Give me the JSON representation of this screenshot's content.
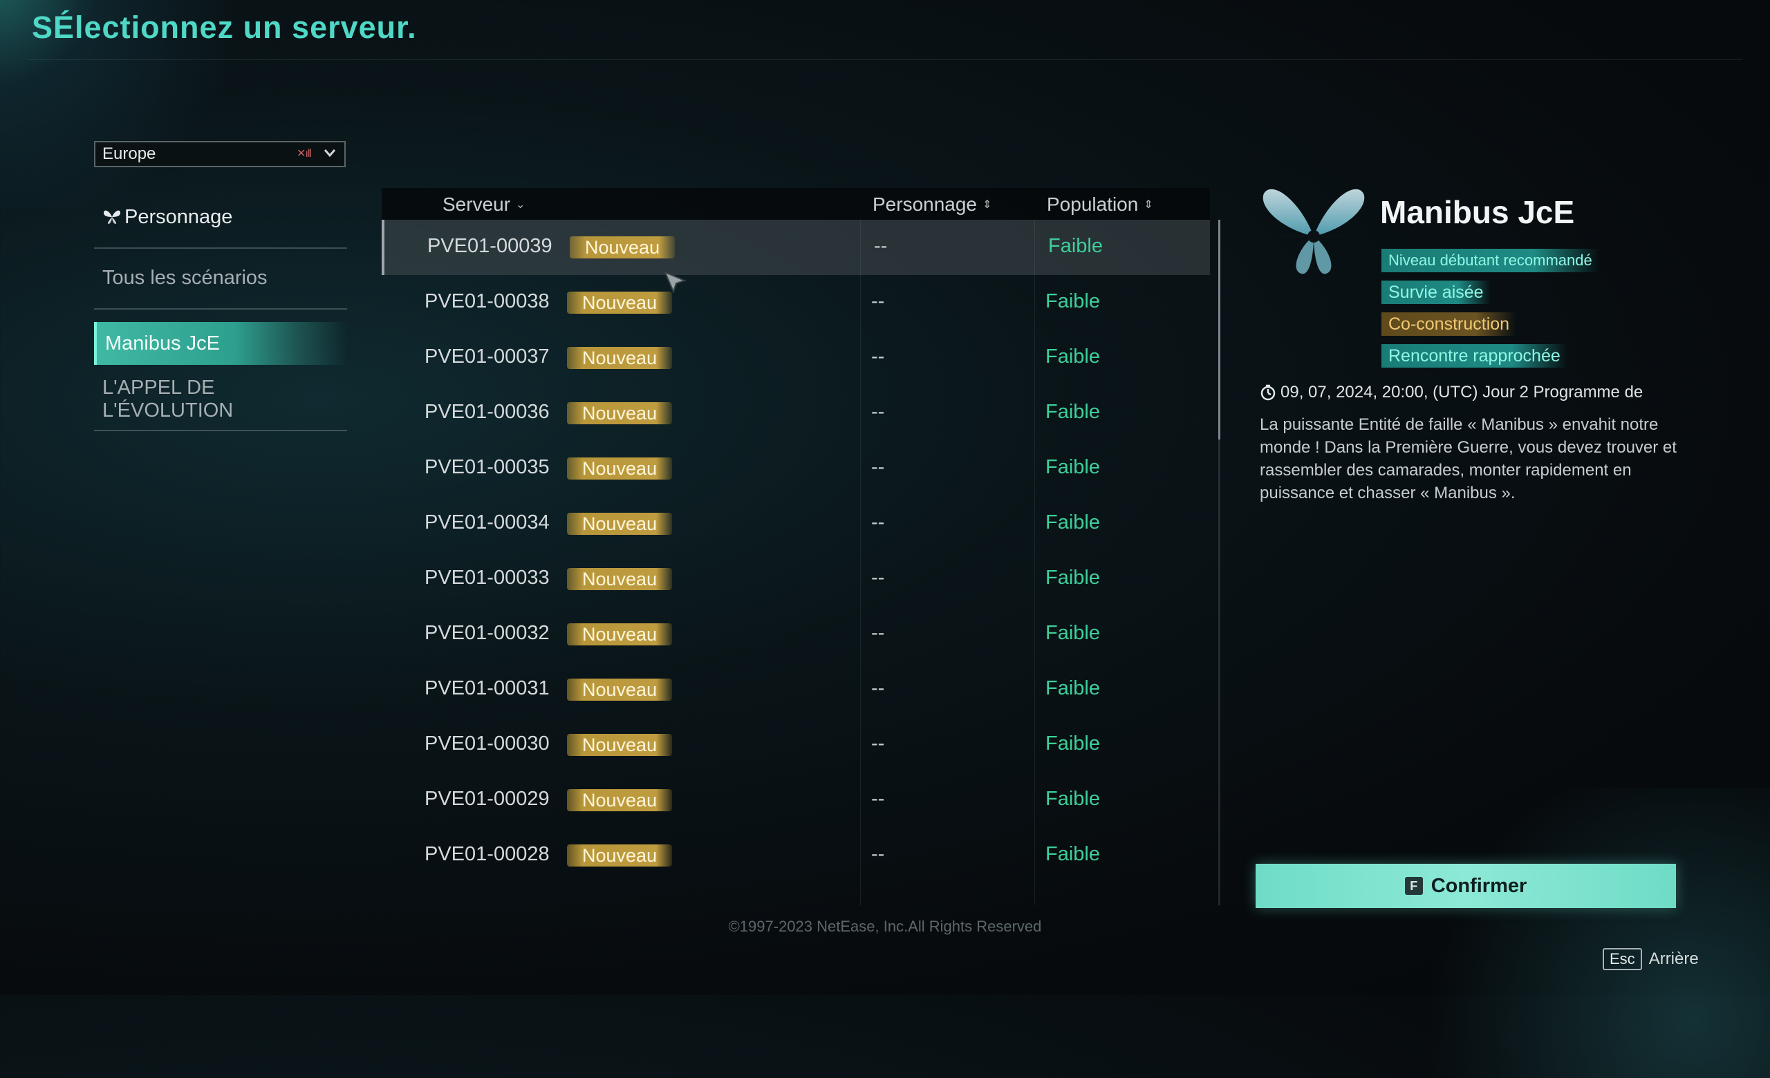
{
  "header": {
    "title": "SÉlectionnez un serveur."
  },
  "region": {
    "value": "Europe"
  },
  "sidebar": {
    "items": [
      {
        "label": "Personnage"
      },
      {
        "label": "Tous les scénarios"
      },
      {
        "label": "Manibus JcE"
      },
      {
        "label": "L'APPEL DE L'ÉVOLUTION"
      }
    ]
  },
  "table": {
    "headers": {
      "server": "Serveur",
      "character": "Personnage",
      "population": "Population"
    },
    "rows": [
      {
        "server": "PVE01-00039",
        "badge": "Nouveau",
        "character": "--",
        "population": "Faible"
      },
      {
        "server": "PVE01-00038",
        "badge": "Nouveau",
        "character": "--",
        "population": "Faible"
      },
      {
        "server": "PVE01-00037",
        "badge": "Nouveau",
        "character": "--",
        "population": "Faible"
      },
      {
        "server": "PVE01-00036",
        "badge": "Nouveau",
        "character": "--",
        "population": "Faible"
      },
      {
        "server": "PVE01-00035",
        "badge": "Nouveau",
        "character": "--",
        "population": "Faible"
      },
      {
        "server": "PVE01-00034",
        "badge": "Nouveau",
        "character": "--",
        "population": "Faible"
      },
      {
        "server": "PVE01-00033",
        "badge": "Nouveau",
        "character": "--",
        "population": "Faible"
      },
      {
        "server": "PVE01-00032",
        "badge": "Nouveau",
        "character": "--",
        "population": "Faible"
      },
      {
        "server": "PVE01-00031",
        "badge": "Nouveau",
        "character": "--",
        "population": "Faible"
      },
      {
        "server": "PVE01-00030",
        "badge": "Nouveau",
        "character": "--",
        "population": "Faible"
      },
      {
        "server": "PVE01-00029",
        "badge": "Nouveau",
        "character": "--",
        "population": "Faible"
      },
      {
        "server": "PVE01-00028",
        "badge": "Nouveau",
        "character": "--",
        "population": "Faible"
      }
    ]
  },
  "footer": {
    "copyright": "©1997-2023 NetEase, Inc.All Rights Reserved"
  },
  "panel": {
    "title": "Manibus JcE",
    "tags": [
      {
        "label": "Niveau débutant recommandé",
        "color": "teal"
      },
      {
        "label": "Survie aisée",
        "color": "teal"
      },
      {
        "label": "Co-construction",
        "color": "gold"
      },
      {
        "label": "Rencontre rapprochée",
        "color": "teal"
      }
    ],
    "schedule": "09, 07, 2024, 20:00, (UTC) Jour 2   Programme de",
    "description": "La puissante Entité de faille « Manibus » envahit notre monde ! Dans la Première Guerre, vous devez trouver et rassembler des camarades, monter rapidement en puissance et chasser « Manibus »."
  },
  "actions": {
    "confirm_key": "F",
    "confirm_label": "Confirmer",
    "back_key": "Esc",
    "back_label": "Arrière"
  },
  "colors": {
    "accent": "#4fd8c6",
    "population_low": "#3fcf9a",
    "badge_gold": "#bf9c40",
    "confirm_bg": "#8ce9d6"
  }
}
